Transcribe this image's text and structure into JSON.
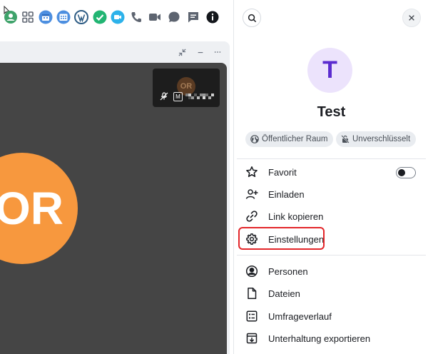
{
  "topbar": {
    "icons": [
      "home-icon",
      "apps-grid-icon",
      "calendar-icon",
      "calendar-week-icon",
      "wordpress-icon",
      "check-circle-icon",
      "meet-icon",
      "phone-icon",
      "video-icon",
      "chat-bubble-icon",
      "message-icon",
      "info-icon"
    ]
  },
  "call": {
    "main_avatar_initials": "OR",
    "pip_initials": "OR",
    "pip_badge": "M",
    "header_buttons": [
      "minimize-call-icon",
      "minimize-icon",
      "more-icon"
    ],
    "colors": {
      "stage": "#454545",
      "avatar": "#f7983e"
    }
  },
  "room": {
    "avatar_letter": "T",
    "name": "Test",
    "badges": [
      {
        "label": "Öffentlicher Raum",
        "icon": "globe-icon"
      },
      {
        "label": "Unverschlüsselt",
        "icon": "unlock-icon"
      }
    ],
    "favorite_enabled": false
  },
  "menu": {
    "group1": [
      {
        "label": "Favorit",
        "icon": "star-icon"
      },
      {
        "label": "Einladen",
        "icon": "user-add-icon"
      },
      {
        "label": "Link kopieren",
        "icon": "link-icon"
      },
      {
        "label": "Einstellungen",
        "icon": "gear-icon"
      }
    ],
    "group2": [
      {
        "label": "Personen",
        "icon": "person-icon"
      },
      {
        "label": "Dateien",
        "icon": "file-icon"
      },
      {
        "label": "Umfrageverlauf",
        "icon": "poll-icon"
      },
      {
        "label": "Unterhaltung exportieren",
        "icon": "export-icon"
      }
    ]
  },
  "colors": {
    "accent": "#5b2ccf",
    "highlight": "#e3262a"
  }
}
